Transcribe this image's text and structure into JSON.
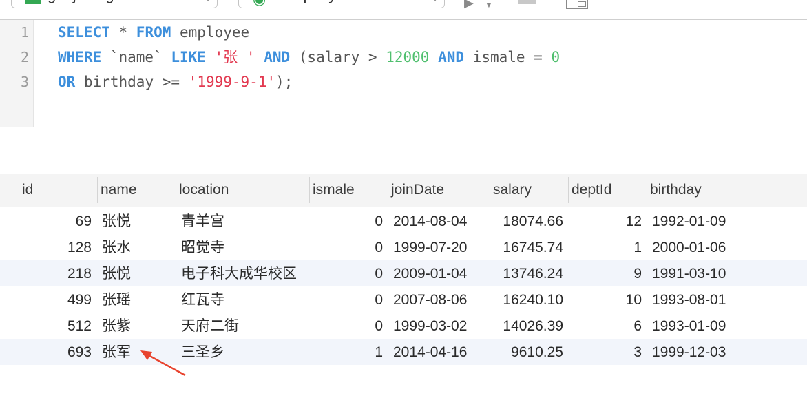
{
  "toolbar": {
    "connection": {
      "label": "gaojufeng",
      "icon": "connection-icon"
    },
    "database": {
      "label": "company",
      "icon": "database-icon"
    },
    "run_icon": "play-icon",
    "stop_icon": "stop-icon",
    "explain_icon": "explain-icon"
  },
  "editor": {
    "line_numbers": [
      "1",
      "2",
      "3"
    ],
    "lines": [
      [
        {
          "t": "SELECT",
          "c": "kw"
        },
        {
          "t": " * ",
          "c": ""
        },
        {
          "t": "FROM",
          "c": "kw"
        },
        {
          "t": " employee",
          "c": ""
        }
      ],
      [
        {
          "t": "WHERE",
          "c": "kw"
        },
        {
          "t": " `name` ",
          "c": ""
        },
        {
          "t": "LIKE",
          "c": "kw"
        },
        {
          "t": " ",
          "c": ""
        },
        {
          "t": "'张_'",
          "c": "str"
        },
        {
          "t": " ",
          "c": ""
        },
        {
          "t": "AND",
          "c": "kw"
        },
        {
          "t": " (salary > ",
          "c": ""
        },
        {
          "t": "12000",
          "c": "num"
        },
        {
          "t": " ",
          "c": ""
        },
        {
          "t": "AND",
          "c": "kw"
        },
        {
          "t": " ismale = ",
          "c": ""
        },
        {
          "t": "0",
          "c": "num"
        }
      ],
      [
        {
          "t": "OR",
          "c": "kw"
        },
        {
          "t": " birthday >= ",
          "c": ""
        },
        {
          "t": "'1999-9-1'",
          "c": "str"
        },
        {
          "t": ");",
          "c": ""
        }
      ]
    ]
  },
  "results": {
    "columns": [
      "id",
      "name",
      "location",
      "ismale",
      "joinDate",
      "salary",
      "deptId",
      "birthday"
    ],
    "rows": [
      [
        "69",
        "张悦",
        "青羊宫",
        "0",
        "2014-08-04",
        "18074.66",
        "12",
        "1992-01-09"
      ],
      [
        "128",
        "张水",
        "昭觉寺",
        "0",
        "1999-07-20",
        "16745.74",
        "1",
        "2000-01-06"
      ],
      [
        "218",
        "张悦",
        "电子科大成华校区",
        "0",
        "2009-01-04",
        "13746.24",
        "9",
        "1991-03-10"
      ],
      [
        "499",
        "张瑶",
        "红瓦寺",
        "0",
        "2007-08-06",
        "16240.10",
        "10",
        "1993-08-01"
      ],
      [
        "512",
        "张紫",
        "天府二街",
        "0",
        "1999-03-02",
        "14026.39",
        "6",
        "1993-01-09"
      ],
      [
        "693",
        "张军",
        "三圣乡",
        "1",
        "2014-04-16",
        "9610.25",
        "3",
        "1999-12-03"
      ]
    ]
  },
  "annotation": {
    "color": "#e8432e",
    "icon": "annotation-arrow-icon"
  }
}
